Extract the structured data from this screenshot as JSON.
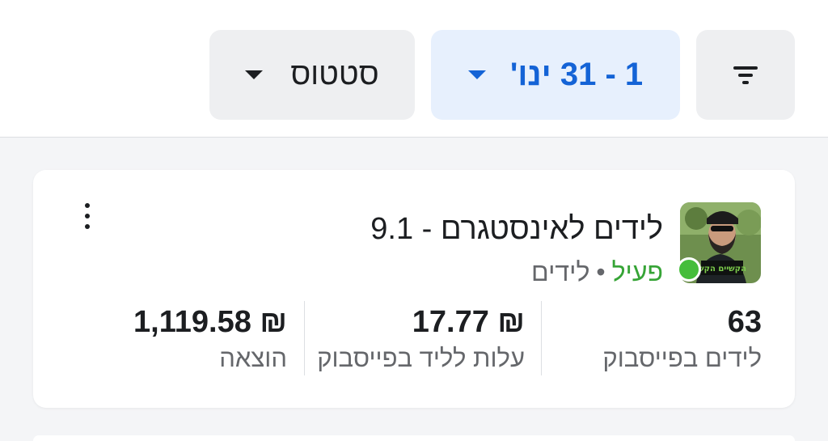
{
  "toolbar": {
    "status_label": "סטטוס",
    "date_label": "1 - 31 ינו'",
    "filter_icon": "filter-icon",
    "accent_color": "#1463d6"
  },
  "campaign": {
    "title": "לידים לאינסטגרם - 9.1",
    "status": "פעיל",
    "separator": "•",
    "type": "לידים",
    "status_color": "#45bd3b",
    "avatar_text": "הקשיים הקש",
    "metrics": [
      {
        "value": "63",
        "label": "לידים בפייסבוק"
      },
      {
        "value": "₪ 17.77",
        "label": "עלות לליד בפייסבוק"
      },
      {
        "value": "₪ 1,119.58",
        "label": "הוצאה"
      }
    ]
  }
}
